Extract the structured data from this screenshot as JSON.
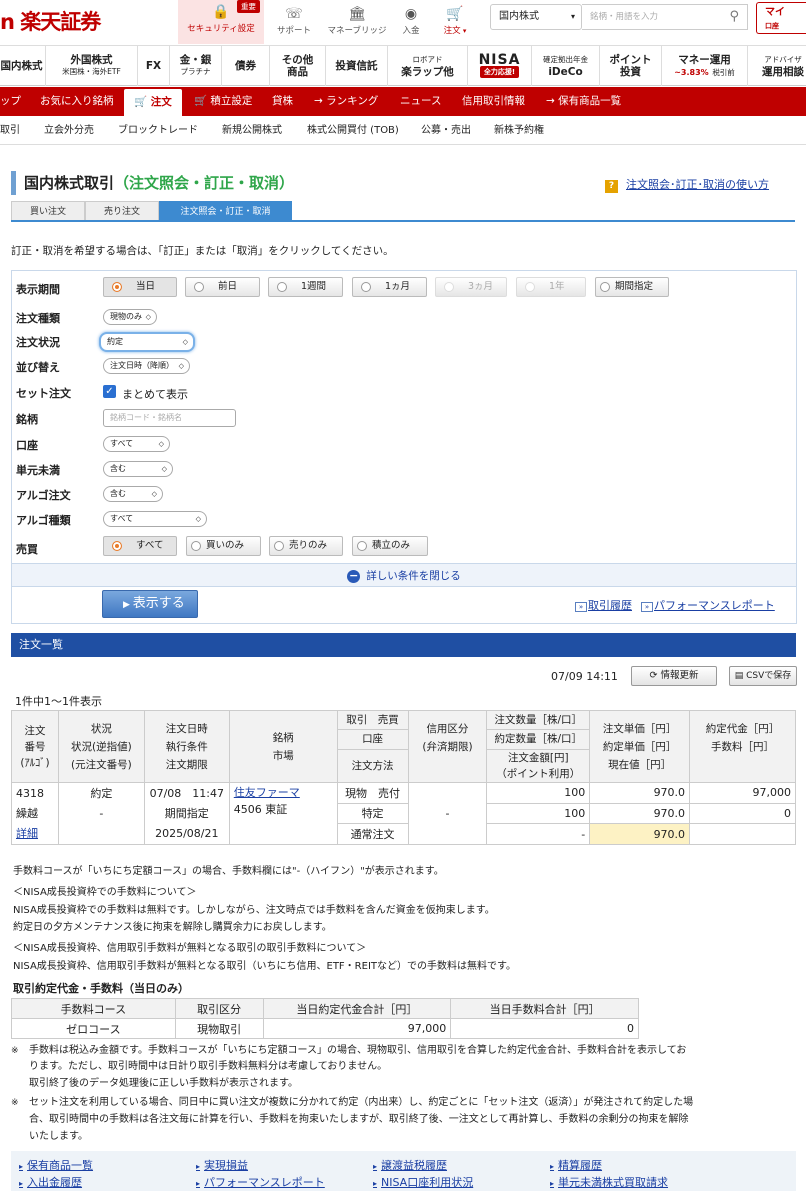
{
  "header": {
    "logo": "n 楽天証券",
    "security_label": "セキュリティ設定",
    "security_badge": "重要",
    "support_label": "サポート",
    "money_bridge_label": "マネーブリッジ",
    "deposit_label": "入金",
    "order_label": "注文",
    "market_select": "国内株式",
    "search_placeholder": "銘柄・用語を入力",
    "mypage_label_1": "マイ",
    "mypage_label_2": "口座"
  },
  "nav": {
    "items": [
      {
        "main": "国内株式",
        "sub": ""
      },
      {
        "main": "外国株式",
        "sub": "米国株・海外ETF"
      },
      {
        "main": "FX",
        "sub": ""
      },
      {
        "main": "金・銀",
        "sub": "プラチナ"
      },
      {
        "main": "債券",
        "sub": ""
      },
      {
        "main": "その他",
        "sub": "商品"
      },
      {
        "main": "投資信託",
        "sub": ""
      },
      {
        "main": "ロボアド",
        "sub": "楽ラップ他"
      },
      {
        "main": "NISA",
        "sub": "全力応援!"
      },
      {
        "main": "確定拠出年金",
        "sub": "iDeCo"
      },
      {
        "main": "ポイント",
        "sub": "投資"
      },
      {
        "main": "マネー運用",
        "sub": "~3.83%",
        "sub2": "税引前"
      },
      {
        "main": "アドバイザ",
        "sub": "運用相談"
      }
    ]
  },
  "redbar": {
    "items": [
      "ップ",
      "お気に入り銘柄",
      "注文",
      "積立設定",
      "貸株",
      "→ ランキング",
      "ニュース",
      "信用取引情報",
      "→ 保有商品一覧"
    ]
  },
  "subbar": {
    "items": [
      "取引",
      "立会外分売",
      "ブロックトレード",
      "新規公開株式",
      "株式公開買付 (TOB)",
      "公募・売出",
      "新株予約権"
    ]
  },
  "page": {
    "title_main": "国内株式取引",
    "title_sub": "（注文照会・訂正・取消）",
    "help_link": "注文照会･訂正･取消の使い方",
    "tabs": [
      "買い注文",
      "売り注文",
      "注文照会・訂正・取消"
    ],
    "instruction": "訂正・取消を希望する場合は、「訂正」または「取消」をクリックしてください。"
  },
  "filter": {
    "period_label": "表示期間",
    "period_options": [
      "当日",
      "前日",
      "1週間",
      "1ヵ月",
      "3ヵ月",
      "1年",
      "期間指定"
    ],
    "order_type_label": "注文種類",
    "order_type_value": "現物のみ",
    "status_label": "注文状況",
    "status_value": "約定",
    "sort_label": "並び替え",
    "sort_value": "注文日時（降順）",
    "set_label": "セット注文",
    "set_value": "まとめて表示",
    "ticker_label": "銘柄",
    "ticker_placeholder": "銘柄コード・銘柄名",
    "account_label": "口座",
    "account_value": "すべて",
    "odd_label": "単元未満",
    "odd_value": "含む",
    "algo_label": "アルゴ注文",
    "algo_value": "含む",
    "algo_type_label": "アルゴ種類",
    "algo_type_value": "すべて",
    "trade_label": "売買",
    "trade_options": [
      "すべて",
      "買いのみ",
      "売りのみ",
      "積立のみ"
    ],
    "detail_toggle": "詳しい条件を閉じる",
    "show_button": "表示する",
    "link_history": "取引履歴",
    "link_performance": "パフォーマンスレポート"
  },
  "list": {
    "header": "注文一覧",
    "timestamp": "07/09 14:11",
    "refresh_button": "情報更新",
    "csv_button": "CSVで保存",
    "count": "1件中1～1件表示",
    "columns": {
      "c1": [
        "注文",
        "番号",
        "(ｱﾙｺﾞ)"
      ],
      "c2": [
        "状況",
        "状況(逆指値)",
        "(元注文番号)"
      ],
      "c3": [
        "注文日時",
        "執行条件",
        "注文期限"
      ],
      "c4": [
        "銘柄",
        "市場"
      ],
      "c5a": "取引　売買",
      "c5b": "口座",
      "c5c": "注文方法",
      "c6": [
        "信用区分",
        "(弁済期限)"
      ],
      "c7a": "注文数量［株/口］",
      "c7b": "約定数量［株/口］",
      "c7c": "注文金額[円]",
      "c7d": "（ポイント利用）",
      "c8": [
        "注文単価［円］",
        "約定単価［円］",
        "現在値［円］"
      ],
      "c9": [
        "約定代金［円］",
        "手数料［円］"
      ]
    },
    "row": {
      "order_no": "4318",
      "carry": "繰越",
      "detail": "詳細",
      "status": "約定",
      "status_sub": "-",
      "date": "07/08　11:47",
      "exec_cond": "期間指定",
      "expiry": "2025/08/21",
      "stock_name": "住友ファーマ",
      "stock_code": "4506 東証",
      "trade": "現物　売付",
      "account": "特定",
      "method": "通常注文",
      "margin": "-",
      "qty": "100",
      "exec_qty": "100",
      "order_amount": "-",
      "price": "970.0",
      "exec_price": "970.0",
      "current_price": "970.0",
      "amount": "97,000",
      "fee": "0"
    }
  },
  "notes": {
    "n1": "手数料コースが「いちにち定額コース」の場合、手数料欄には\"-（ハイフン）\"が表示されます。",
    "n2": "＜NISA成長投資枠での手数料について＞",
    "n3": "NISA成長投資枠での手数料は無料です。しかしながら、注文時点では手数料を含んだ資金を仮拘束します。",
    "n4": "約定日の夕方メンテナンス後に拘束を解除し購買余力にお戻しします。",
    "n5": "＜NISA成長投資枠、信用取引手数料が無料となる取引の取引手数料について＞",
    "n6": "NISA成長投資枠、信用取引手数料が無料となる取引（いちにち信用、ETF・REITなど）での手数料は無料です。"
  },
  "fees": {
    "title": "取引約定代金・手数料（当日のみ）",
    "headers": [
      "手数料コース",
      "取引区分",
      "当日約定代金合計［円］",
      "当日手数料合計［円］"
    ],
    "row": [
      "ゼロコース",
      "現物取引",
      "97,000",
      "0"
    ]
  },
  "footnotes": {
    "f1a": "手数料は税込み金額です。手数料コースが「いちにち定額コース」の場合、現物取引、信用取引を合算した約定代金合計、手数料合計を表示してお",
    "f1b": "ります。ただし、取引時間中は日計り取引手数料無料分は考慮しておりません。",
    "f1c": "取引終了後のデータ処理後に正しい手数料が表示されます。",
    "f2a": "セット注文を利用している場合、同日中に買い注文が複数に分かれて約定（内出来）し、約定ごとに「セット注文（返済）」が発注されて約定した場",
    "f2b": "合、取引時間中の手数料は各注文毎に計算を行い、手数料を拘束いたしますが、取引終了後、一注文として再計算し、手数料の余剰分の拘束を解除",
    "f2c": "いたします。",
    "mark": "※"
  },
  "bottom_links": [
    "保有商品一覧",
    "実現損益",
    "譲渡益税履歴",
    "精算履歴",
    "入出金履歴",
    "パフォーマンスレポート",
    "NISA口座利用状況",
    "単元未満株式買取請求"
  ]
}
